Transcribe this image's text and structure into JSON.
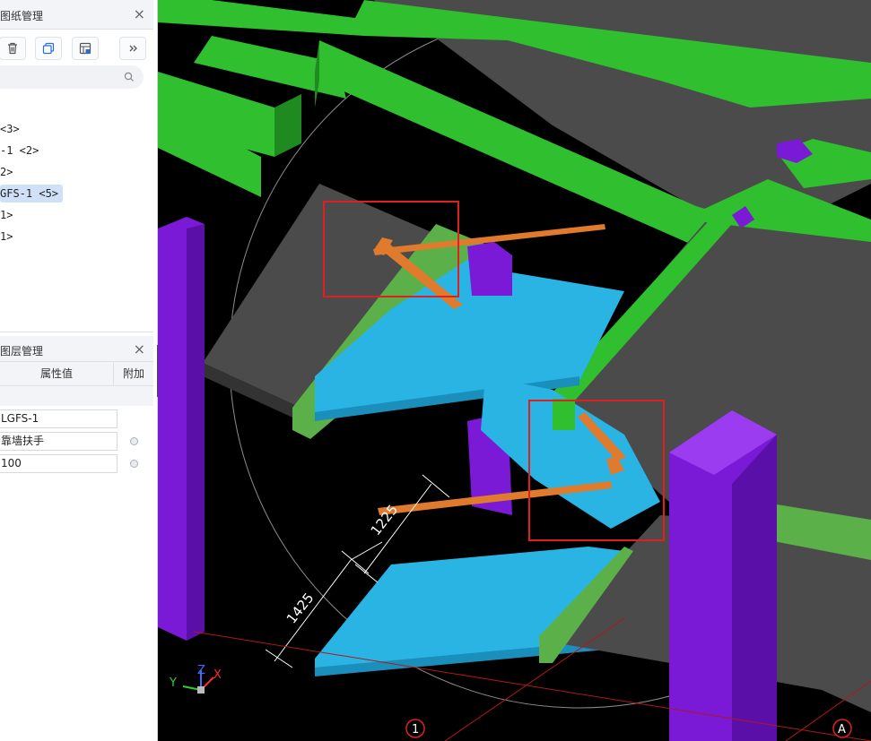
{
  "drawing_panel": {
    "title": "图纸管理",
    "close_glyph": "×",
    "toolbar": [
      "trash-icon",
      "copy-icon",
      "layer-icon",
      "more-icon"
    ],
    "search_placeholder": "",
    "tree_items": [
      "<3>",
      "-1 <2>",
      "2>",
      "GFS-1 <5>",
      "1>",
      "1>"
    ],
    "selected_index": 3
  },
  "layer_panel": {
    "title": "图层管理",
    "close_glyph": "×",
    "columns": {
      "value": "属性值",
      "extra": "附加"
    },
    "rows": [
      {
        "value": "LGFS-1"
      },
      {
        "value": "靠墙扶手"
      },
      {
        "value": "100"
      }
    ]
  },
  "viewport": {
    "dimensions": [
      "1225",
      "1425"
    ],
    "axis_labels": {
      "x": "X",
      "y": "Y",
      "z": "Z"
    },
    "grid_markers": [
      "1",
      "A"
    ],
    "colors": {
      "slab": "#4b4b4b",
      "beam": "#2fbf2f",
      "column": "#7a1ad6",
      "stair": "#2ab4e4",
      "railing": "#e07a2c",
      "highlight": "#e02020"
    }
  },
  "collapse_glyph": "‹"
}
